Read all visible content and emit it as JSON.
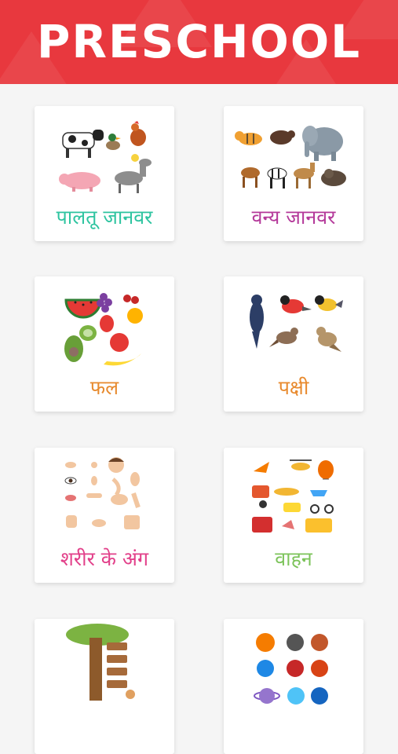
{
  "header": {
    "title": "PRESCHOOL"
  },
  "cards": [
    {
      "label": "पालतू जानवर",
      "icon": "farm-animals-icon",
      "color": "#2ec4a0"
    },
    {
      "label": "वन्य जानवर",
      "icon": "wild-animals-icon",
      "color": "#b4399a"
    },
    {
      "label": "फल",
      "icon": "fruits-icon",
      "color": "#e78a2e"
    },
    {
      "label": "पक्षी",
      "icon": "birds-icon",
      "color": "#e88a2e"
    },
    {
      "label": "शरीर के अंग",
      "icon": "body-parts-icon",
      "color": "#e2408a"
    },
    {
      "label": "वाहन",
      "icon": "vehicles-icon",
      "color": "#7cc35a"
    },
    {
      "label": "",
      "icon": "tree-icon",
      "color": "#e2408a"
    },
    {
      "label": "",
      "icon": "planets-icon",
      "color": "#e2408a"
    }
  ]
}
